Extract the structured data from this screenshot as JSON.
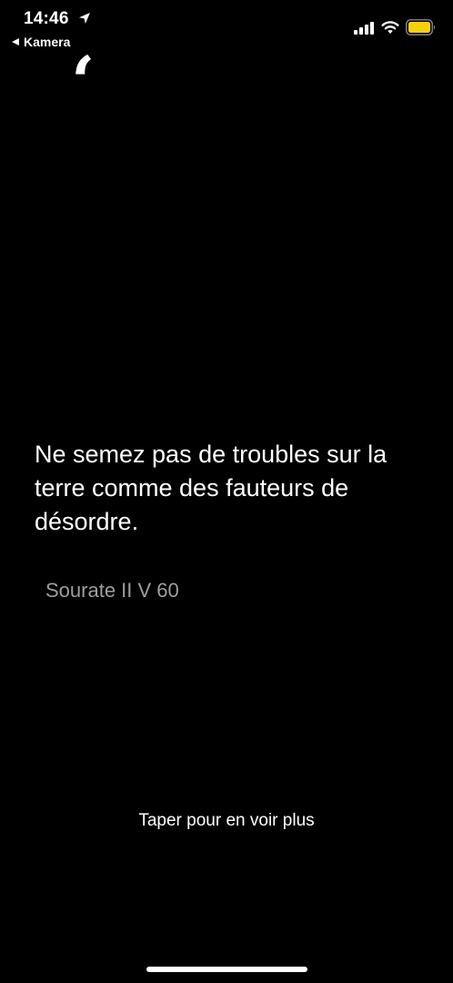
{
  "status_bar": {
    "time": "14:46",
    "back_label": "Kamera",
    "icons": [
      "location-arrow-icon",
      "cellular-signal-icon",
      "wifi-icon",
      "battery-icon"
    ],
    "battery_color": "#f5d10d"
  },
  "quote": {
    "mark": "‘",
    "text": "Ne semez pas de troubles sur la terre comme des fauteurs de désordre.",
    "source": "Sourate II V 60"
  },
  "footer": {
    "tap_more": "Taper pour en voir plus"
  },
  "colors": {
    "background": "#000000",
    "text": "#ffffff",
    "source_text": "#9e9e9e"
  }
}
